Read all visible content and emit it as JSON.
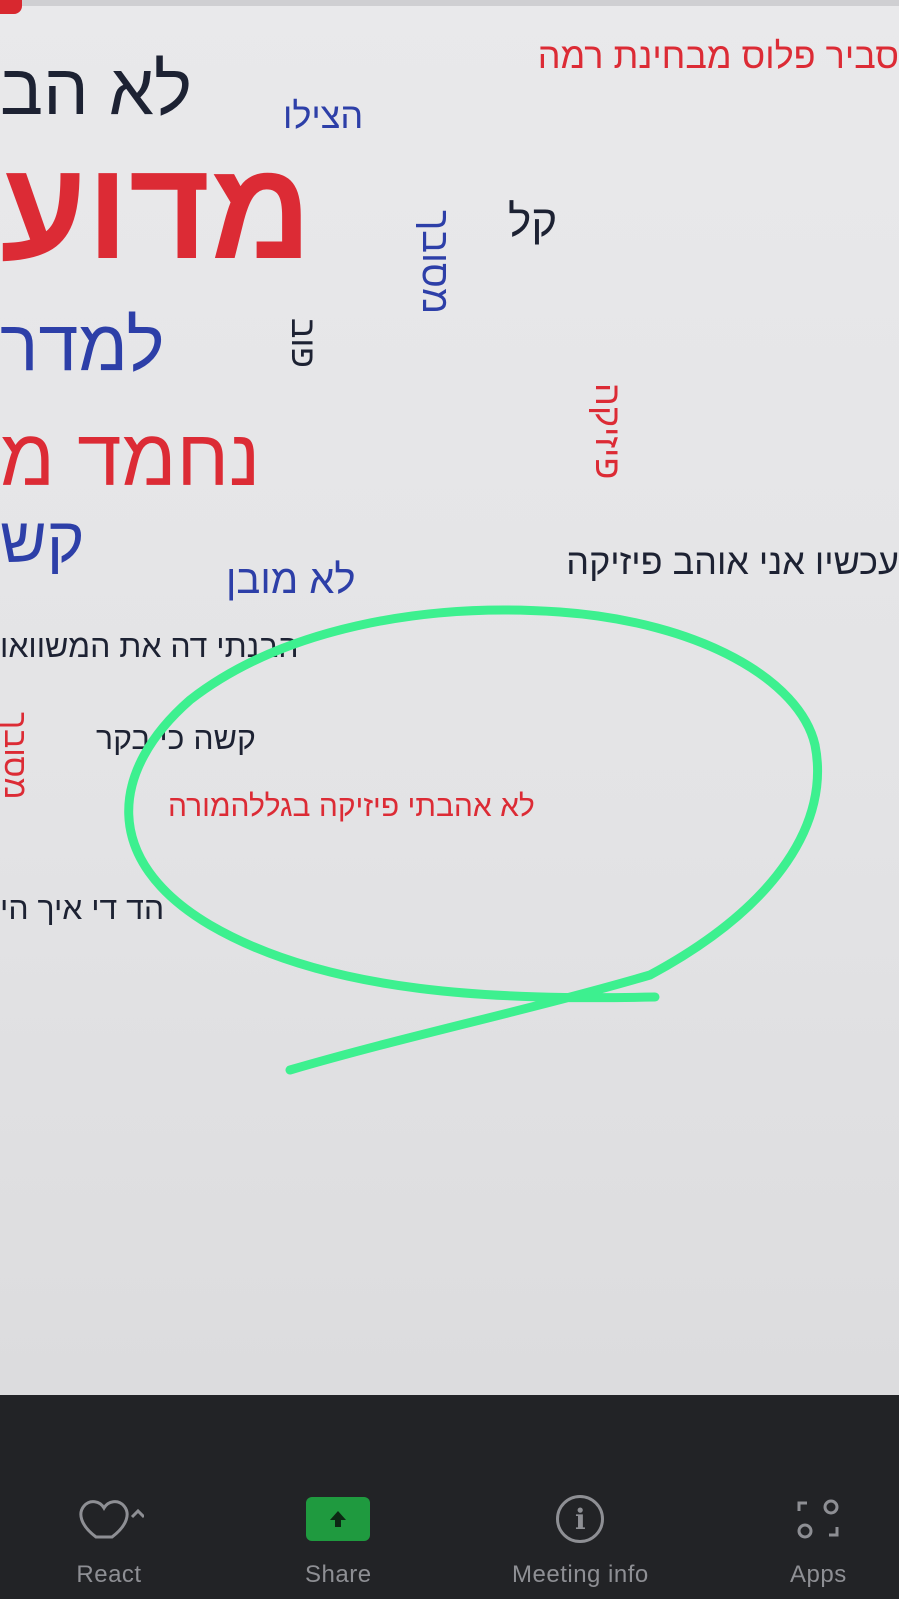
{
  "word_cloud": {
    "words": {
      "w01": "סביר פלוס מבחינת רמה",
      "w02": "לא הב",
      "w03": "הצילו",
      "w04": "מדוע",
      "w05": "קל",
      "w06": "מסובך",
      "w07": "למדר",
      "w08": "פיזיקה",
      "w09": "פוב",
      "w10": "נחמד מ",
      "w11": "קש",
      "w12": "עכשיו אני אוהב פיזיקה",
      "w13": "לא מובן",
      "w14": "הבנתי דה את המשוואו",
      "w15": "קשה כי בקר",
      "w16": "לא אהבתי פיזיקה בגללהמורה",
      "w17": "מסובך",
      "w18": "הד די איך הי"
    }
  },
  "annotation": {
    "color": "#3df08f"
  },
  "toolbar": {
    "react_label": "React",
    "share_label": "Share",
    "meeting_info_label": "Meeting info",
    "apps_label": "Apps"
  },
  "colors": {
    "red_word": "#dc2b35",
    "blue_word": "#2d3fa8",
    "dark_word": "#1d2233",
    "toolbar_bg": "#222326",
    "share_green": "#1f9a3f"
  }
}
